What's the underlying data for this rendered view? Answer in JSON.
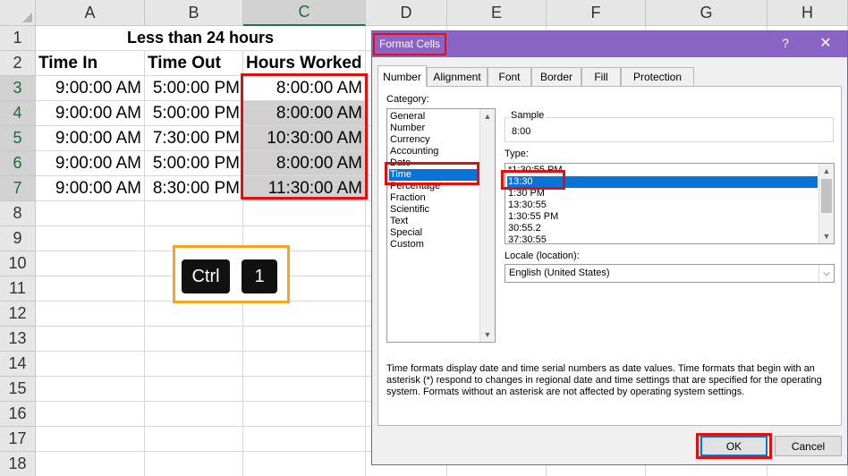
{
  "sheet": {
    "columns": [
      "A",
      "B",
      "C",
      "D",
      "E",
      "F",
      "G",
      "H"
    ],
    "rows": [
      "1",
      "2",
      "3",
      "4",
      "5",
      "6",
      "7",
      "8",
      "9",
      "10",
      "11",
      "12",
      "13",
      "14",
      "15",
      "16",
      "17",
      "18"
    ],
    "title": "Less than 24 hours",
    "headers": [
      "Time In",
      "Time Out",
      "Hours Worked"
    ],
    "data": [
      [
        "9:00:00 AM",
        "5:00:00 PM",
        "8:00:00 AM"
      ],
      [
        "9:00:00 AM",
        "5:00:00 PM",
        "8:00:00 AM"
      ],
      [
        "9:00:00 AM",
        "7:30:00 PM",
        "10:30:00 AM"
      ],
      [
        "9:00:00 AM",
        "5:00:00 PM",
        "8:00:00 AM"
      ],
      [
        "9:00:00 AM",
        "8:30:00 PM",
        "11:30:00 AM"
      ]
    ]
  },
  "keys": [
    "Ctrl",
    "1"
  ],
  "dialog": {
    "title": "Format Cells",
    "help": "?",
    "close": "✕",
    "tabs": [
      "Number",
      "Alignment",
      "Font",
      "Border",
      "Fill",
      "Protection"
    ],
    "category_label": "Category:",
    "categories": [
      "General",
      "Number",
      "Currency",
      "Accounting",
      "Date",
      "Time",
      "Percentage",
      "Fraction",
      "Scientific",
      "Text",
      "Special",
      "Custom"
    ],
    "selected_category": "Time",
    "sample_label": "Sample",
    "sample_value": "8:00",
    "type_label": "Type:",
    "types": [
      "*1:30:55 PM",
      "13:30",
      "1:30 PM",
      "13:30:55",
      "1:30:55 PM",
      "30:55.2",
      "37:30:55"
    ],
    "selected_type": "13:30",
    "locale_label": "Locale (location):",
    "locale_value": "English (United States)",
    "description": "Time formats display date and time serial numbers as date values.  Time formats that begin with an asterisk (*) respond to changes in regional date and time settings that are specified for the operating system. Formats without an asterisk are not affected by operating system settings.",
    "ok_label": "OK",
    "cancel_label": "Cancel"
  },
  "colors": {
    "title_bar": "#8a64c4",
    "highlight": "#e01010",
    "selection": "#0a73d8",
    "shortcut_box": "#f0a820"
  },
  "icons": [
    "help-icon",
    "close-icon",
    "scroll-up-icon",
    "scroll-down-icon",
    "dropdown-chevron-icon"
  ]
}
